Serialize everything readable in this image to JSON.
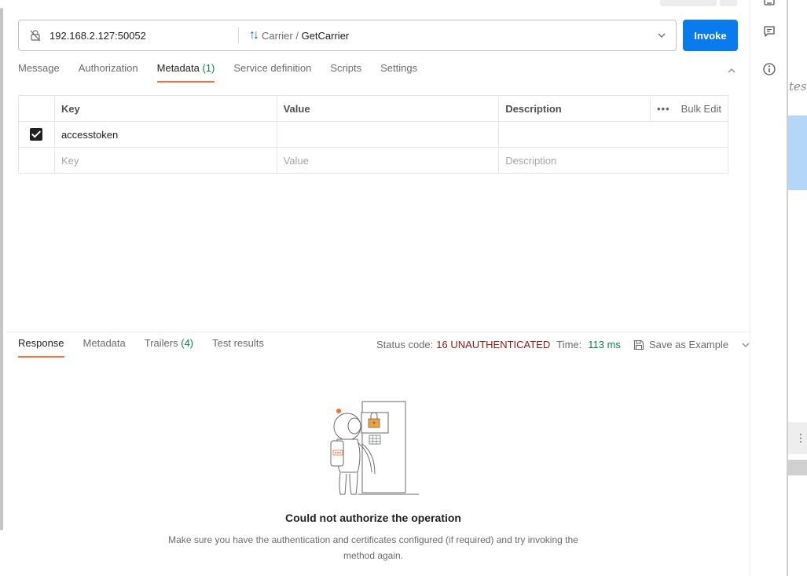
{
  "request": {
    "host": "192.168.2.127:50052",
    "service": "Carrier",
    "separator": " / ",
    "method": "GetCarrier",
    "invoke_label": "Invoke"
  },
  "tabs": [
    {
      "label": "Message"
    },
    {
      "label": "Authorization"
    },
    {
      "label": "Metadata",
      "count": "(1)",
      "active": true
    },
    {
      "label": "Service definition"
    },
    {
      "label": "Scripts"
    },
    {
      "label": "Settings"
    }
  ],
  "metadata_table": {
    "headers": {
      "key": "Key",
      "value": "Value",
      "description": "Description",
      "bulk_edit": "Bulk Edit"
    },
    "rows": [
      {
        "checked": true,
        "key": "accesstoken",
        "value": "",
        "description": ""
      }
    ],
    "placeholder": {
      "key": "Key",
      "value": "Value",
      "description": "Description"
    }
  },
  "response": {
    "tabs": [
      {
        "label": "Response",
        "active": true
      },
      {
        "label": "Metadata"
      },
      {
        "label": "Trailers",
        "count": "(4)"
      },
      {
        "label": "Test results"
      }
    ],
    "status_label": "Status code:",
    "status_value": "16 UNAUTHENTICATED",
    "time_label": "Time:",
    "time_value": "113 ms",
    "save_example": "Save as Example"
  },
  "empty_state": {
    "title": "Could not authorize the operation",
    "description": "Make sure you have the authentication and certificates configured (if required) and try invoking the method again."
  },
  "right_panel": {
    "partial_text": "tes"
  },
  "colors": {
    "accent_orange": "#ff6c37",
    "invoke_blue": "#097bed",
    "success_green": "#0a8545",
    "error_red": "#8e1a10"
  }
}
